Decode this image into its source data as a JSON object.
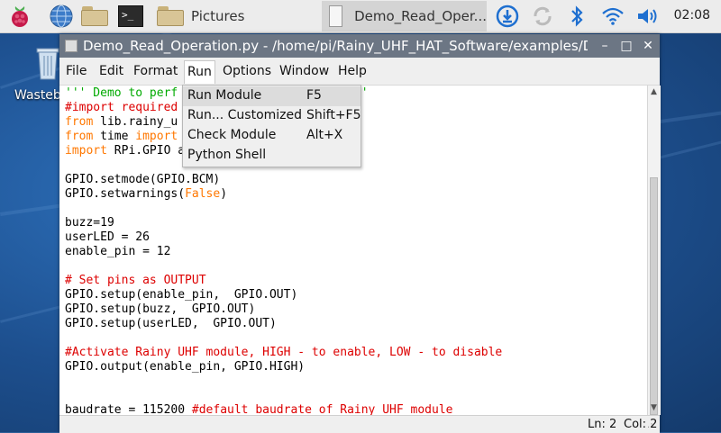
{
  "taskbar": {
    "pictures_label": "Pictures",
    "active_task_label": "Demo_Read_Oper...",
    "clock": "02:08",
    "icons": [
      "raspberry-menu-icon",
      "web-browser-icon",
      "file-manager-icon",
      "terminal-icon",
      "folder-icon",
      "document-icon",
      "download-icon",
      "network-icon",
      "bluetooth-icon",
      "wifi-icon",
      "volume-icon"
    ]
  },
  "desktop": {
    "trash_label": "Wasteb"
  },
  "window": {
    "title": "Demo_Read_Operation.py - /home/pi/Rainy_UHF_HAT_Software/examples/De…",
    "controls": {
      "minimize": "–",
      "maximize": "□",
      "close": "✕"
    }
  },
  "menubar": {
    "items": [
      {
        "label": "File"
      },
      {
        "label": "Edit"
      },
      {
        "label": "Format"
      },
      {
        "label": "Run"
      },
      {
        "label": "Options"
      },
      {
        "label": "Window"
      },
      {
        "label": "Help"
      }
    ]
  },
  "run_menu": {
    "items": [
      {
        "label": "Run Module",
        "accel": "F5"
      },
      {
        "label": "Run... Customized",
        "accel": "Shift+F5"
      },
      {
        "label": "Check Module",
        "accel": "Alt+X"
      },
      {
        "label": "Python Shell",
        "accel": ""
      }
    ]
  },
  "editor": {
    "line1_start": "''' Demo to perf",
    "line1_end": "'''",
    "line2": "#import required",
    "line3_kw": "from",
    "line3_rest": " lib.rainy_u",
    "line4_kw": "from",
    "line4_mid": " time ",
    "line4_kw2": "import",
    "line5_kw": "import",
    "line5_rest": " RPi.GPIO a",
    "line7": "GPIO.setmode(GPIO.BCM)",
    "line8_a": "GPIO.setwarnings(",
    "line8_kw": "False",
    "line8_b": ")",
    "line10": "buzz=19",
    "line11": "userLED = 26",
    "line12": "enable_pin = 12",
    "line14": "# Set pins as OUTPUT",
    "line15": "GPIO.setup(enable_pin,  GPIO.OUT)",
    "line16": "GPIO.setup(buzz,  GPIO.OUT)",
    "line17": "GPIO.setup(userLED,  GPIO.OUT)",
    "line19": "#Activate Rainy UHF module, HIGH - to enable, LOW - to disable",
    "line20": "GPIO.output(enable_pin, GPIO.HIGH)",
    "line23_a": "baudrate = 115200 ",
    "line23_com": "#default baudrate of Rainy UHF module"
  },
  "statusbar": {
    "ln": "Ln: 2",
    "col": "Col: 2"
  },
  "colors": {
    "string": "#00aa00",
    "keyword": "#ff7700",
    "comment": "#dd0000",
    "titlebar": "#6c7684"
  }
}
